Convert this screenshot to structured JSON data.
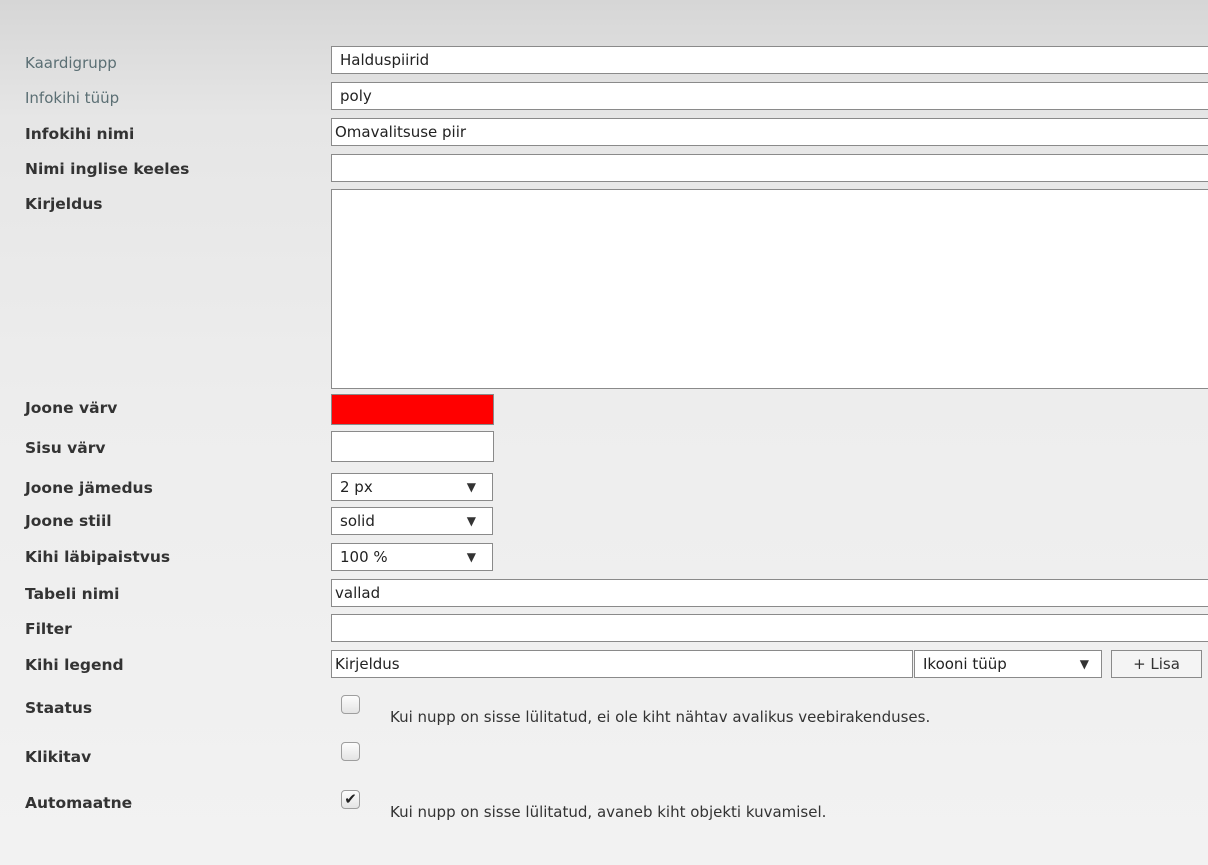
{
  "form": {
    "kaardigrupp": {
      "label": "Kaardigrupp",
      "value": "Halduspiirid"
    },
    "infokihi_tyyp": {
      "label": "Infokihi tüüp",
      "value": "poly"
    },
    "infokihi_nimi": {
      "label": "Infokihi nimi",
      "value": "Omavalitsuse piir"
    },
    "nimi_inglise": {
      "label": "Nimi inglise keeles",
      "value": ""
    },
    "kirjeldus": {
      "label": "Kirjeldus",
      "value": ""
    },
    "joone_varv": {
      "label": "Joone värv",
      "color": "#ff0000"
    },
    "sisu_varv": {
      "label": "Sisu värv",
      "color": "#ffffff"
    },
    "joone_jamedus": {
      "label": "Joone jämedus",
      "value": "2 px"
    },
    "joone_stiil": {
      "label": "Joone stiil",
      "value": "solid"
    },
    "labipaistvus": {
      "label": "Kihi läbipaistvus",
      "value": "100 %"
    },
    "tabeli_nimi": {
      "label": "Tabeli nimi",
      "value": "vallad"
    },
    "filter": {
      "label": "Filter",
      "value": ""
    },
    "kihi_legend": {
      "label": "Kihi legend",
      "value": "Kirjeldus",
      "icon_type": "Ikooni tüüp",
      "add_button": "+ Lisa"
    },
    "staatus": {
      "label": "Staatus",
      "checked": false,
      "note": "Kui nupp on sisse lülitatud, ei ole kiht nähtav avalikus veebirakenduses."
    },
    "klikitav": {
      "label": "Klikitav",
      "checked": false
    },
    "automaatne": {
      "label": "Automaatne",
      "checked": true,
      "note": "Kui nupp on sisse lülitatud, avaneb kiht objekti kuvamisel."
    }
  },
  "icons": {
    "dropdown": "triangle-down-icon",
    "checkmark": "checkmark-icon"
  },
  "symbols": {
    "arrow": "▼",
    "check": "✔"
  }
}
